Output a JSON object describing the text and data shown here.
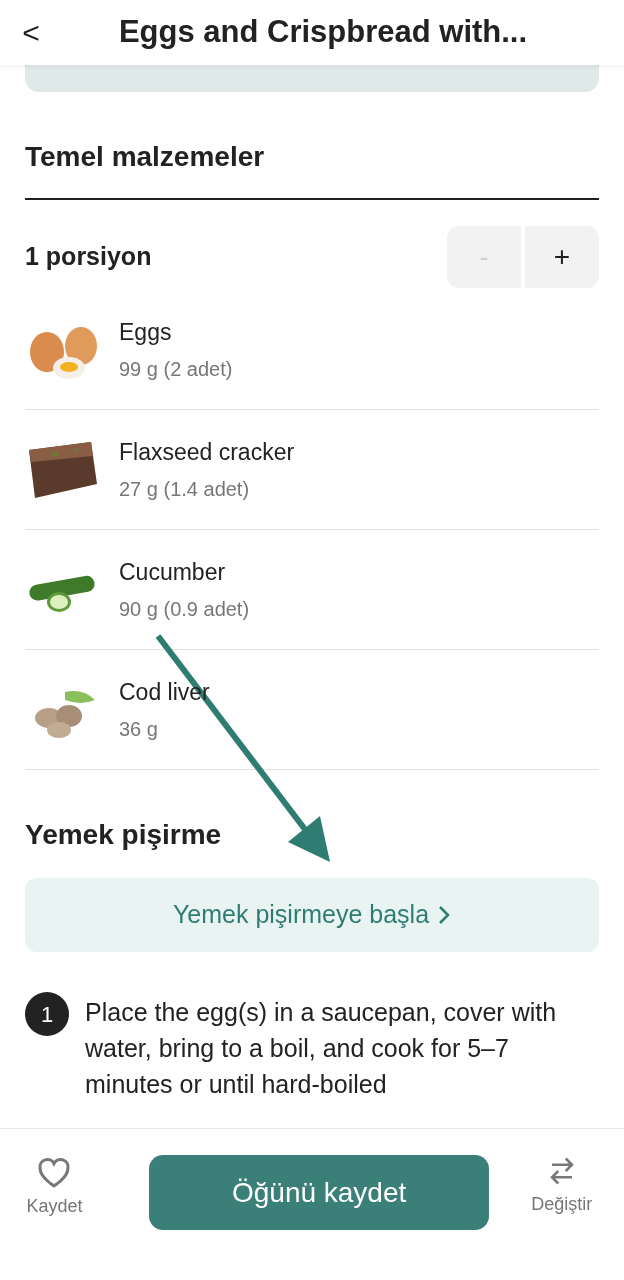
{
  "header": {
    "back": "<",
    "title": "Eggs and Crispbread with..."
  },
  "ingredients_section": {
    "title": "Temel malzemeler",
    "servings": "1 porsiyon",
    "stepper": [
      {
        "label": "-",
        "disabled": true
      },
      {
        "label": "+",
        "disabled": false
      }
    ],
    "items": [
      {
        "name": "Eggs",
        "amount": "99 g (2 adet)"
      },
      {
        "name": "Flaxseed cracker",
        "amount": "27 g (1.4 adet)"
      },
      {
        "name": "Cucumber",
        "amount": "90 g (0.9 adet)"
      },
      {
        "name": "Cod liver",
        "amount": "36 g"
      }
    ]
  },
  "cooking_section": {
    "title": "Yemek pişirme",
    "start_button": "Yemek pişirmeye başla",
    "steps": [
      {
        "number": "1",
        "text": "Place the egg(s) in a saucepan, cover with water, bring to a boil, and cook for 5–7 minutes or until hard-boiled"
      }
    ]
  },
  "bottom_bar": {
    "save": "Kaydet",
    "primary": "Öğünü kaydet",
    "swap": "Değiştir"
  }
}
